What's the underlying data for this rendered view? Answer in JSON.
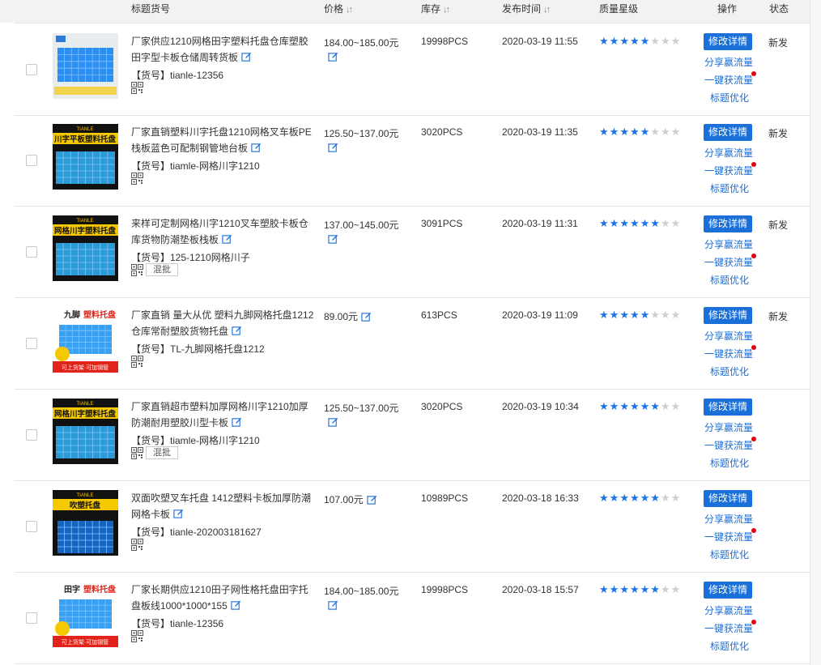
{
  "header": {
    "col_title": "标题货号",
    "col_price": "价格",
    "col_stock": "库存",
    "col_date": "发布时间",
    "col_quality": "质量星级",
    "col_ops": "操作",
    "col_status": "状态",
    "sort_icon": "↓↑"
  },
  "ops": {
    "edit_label": "修改详情",
    "share_label": "分享赢流量",
    "traffic_label": "一键获流量",
    "optimize_label": "标题优化"
  },
  "mix_label": "混批",
  "colors": {
    "accent": "#1a6fd8",
    "star_on": "#1a73e8",
    "dot": "#e60012"
  },
  "rows": [
    {
      "title": "厂家供应1210网格田字塑料托盘仓库塑胶田字型卡板仓储周转货板",
      "sku": "【货号】tianle-12356",
      "price": "184.00~185.00元",
      "stock": "19998PCS",
      "date": "2020-03-19 11:55",
      "stars": 5,
      "status": "新发",
      "mix": false
    },
    {
      "title": "厂家直销塑料川字托盘1210网格叉车板PE栈板蓝色可配制钢管地台板",
      "sku": "【货号】tiamle-网格川字1210",
      "price": "125.50~137.00元",
      "stock": "3020PCS",
      "date": "2020-03-19 11:35",
      "stars": 5,
      "status": "新发",
      "mix": false
    },
    {
      "title": "来样可定制网格川字1210叉车塑胶卡板仓库货物防潮垫板栈板",
      "sku": "【货号】125-1210网格川子",
      "price": "137.00~145.00元",
      "stock": "3091PCS",
      "date": "2020-03-19 11:31",
      "stars": 6,
      "status": "新发",
      "mix": true
    },
    {
      "title": "厂家直销 量大从优 塑料九脚网格托盘1212 仓库常耐塑胶货物托盘",
      "sku": "【货号】TL-九脚网格托盘1212",
      "price": "89.00元",
      "stock": "613PCS",
      "date": "2020-03-19 11:09",
      "stars": 5,
      "status": "新发",
      "mix": false
    },
    {
      "title": "厂家直销超市塑料加厚网格川字1210加厚防潮耐用塑胶川型卡板",
      "sku": "【货号】tiamle-网格川字1210",
      "price": "125.50~137.00元",
      "stock": "3020PCS",
      "date": "2020-03-19 10:34",
      "stars": 6,
      "status": "",
      "mix": true
    },
    {
      "title": "双面吹塑叉车托盘 1412塑料卡板加厚防潮网格卡板",
      "sku": "【货号】tianle-202003181627",
      "price": "107.00元",
      "stock": "10989PCS",
      "date": "2020-03-18 16:33",
      "stars": 6,
      "status": "",
      "mix": false
    },
    {
      "title": "厂家长期供应1210田子网性格托盘田字托盘板线1000*1000*155",
      "sku": "【货号】tianle-12356",
      "price": "184.00~185.00元",
      "stock": "19998PCS",
      "date": "2020-03-18 15:57",
      "stars": 6,
      "status": "",
      "mix": false
    }
  ],
  "thumbs": [
    {
      "kind": "blue-plain",
      "caption_left": "",
      "caption_right": ""
    },
    {
      "kind": "dark",
      "caption_left": "川字平板塑料托盘",
      "caption_right": ""
    },
    {
      "kind": "dark",
      "caption_left": "网格川字塑料托盘",
      "caption_right": ""
    },
    {
      "kind": "white",
      "caption_left": "九脚",
      "caption_right": "塑料托盘",
      "footer": "可上货架·可加钢管"
    },
    {
      "kind": "dark",
      "caption_left": "网格川字塑料托盘",
      "caption_right": ""
    },
    {
      "kind": "dark2",
      "caption_left": "吹塑托盘",
      "caption_right": ""
    },
    {
      "kind": "white",
      "caption_left": "田字",
      "caption_right": "塑料托盘",
      "footer": "可上货架·可加钢管"
    }
  ],
  "brand": "TIANLE"
}
